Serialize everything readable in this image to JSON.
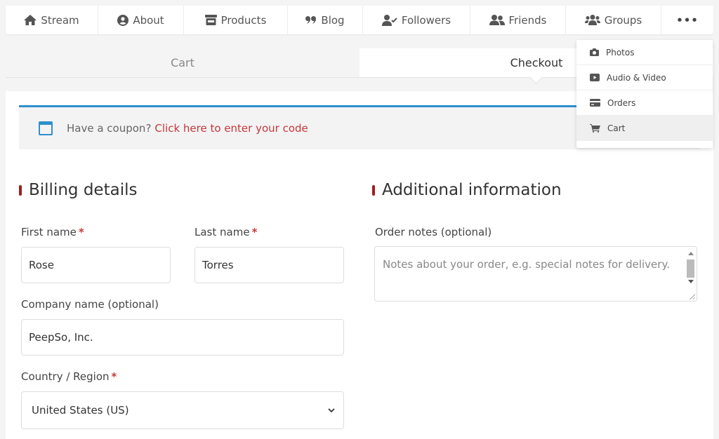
{
  "nav": {
    "items": [
      {
        "label": "Stream",
        "icon": "home-icon"
      },
      {
        "label": "About",
        "icon": "user-circle-icon"
      },
      {
        "label": "Products",
        "icon": "store-icon"
      },
      {
        "label": "Blog",
        "icon": "quote-icon"
      },
      {
        "label": "Followers",
        "icon": "user-check-icon"
      },
      {
        "label": "Friends",
        "icon": "user-friends-icon"
      },
      {
        "label": "Groups",
        "icon": "users-icon"
      }
    ],
    "more_label": "•••"
  },
  "tabs": {
    "cart": "Cart",
    "checkout": "Checkout"
  },
  "coupon": {
    "text": "Have a coupon?",
    "link": "Click here to enter your code"
  },
  "billing": {
    "title": "Billing details",
    "first_name_label": "First name",
    "first_name_value": "Rose",
    "last_name_label": "Last name",
    "last_name_value": "Torres",
    "company_label": "Company name (optional)",
    "company_value": "PeepSo, Inc.",
    "country_label": "Country / Region",
    "country_value": "United States (US)",
    "required_mark": "*"
  },
  "additional": {
    "title": "Additional information",
    "notes_label": "Order notes (optional)",
    "notes_placeholder": "Notes about your order, e.g. special notes for delivery."
  },
  "dropdown": {
    "items": [
      {
        "label": "Photos",
        "icon": "camera-icon"
      },
      {
        "label": "Audio & Video",
        "icon": "video-icon"
      },
      {
        "label": "Orders",
        "icon": "credit-card-icon"
      },
      {
        "label": "Cart",
        "icon": "cart-icon"
      }
    ]
  },
  "colors": {
    "accent": "#2f8fcb",
    "link": "#c7383b",
    "title_bar": "#a01d1d"
  }
}
